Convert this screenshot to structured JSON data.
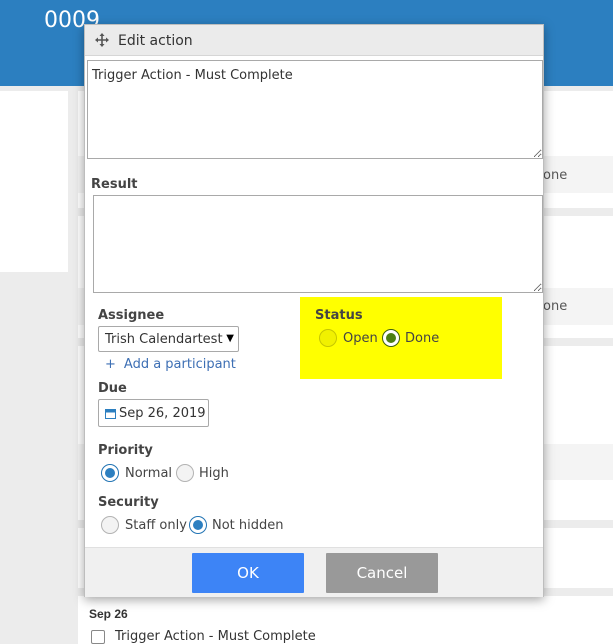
{
  "page": {
    "header_title": "0009",
    "background_done_label_1": "one",
    "background_done_label_2": "one"
  },
  "dialog": {
    "title": "Edit action",
    "action_text": "Trigger Action - Must Complete",
    "result_label": "Result",
    "result_value": "",
    "assignee_label": "Assignee",
    "assignee_value": "Trish Calendartest",
    "add_participant": "Add a participant",
    "due_label": "Due",
    "due_value": "Sep 26, 2019",
    "status_label": "Status",
    "status_options": [
      "Open",
      "Done"
    ],
    "status_selected": "Done",
    "priority_label": "Priority",
    "priority_options": [
      "Normal",
      "High"
    ],
    "priority_selected": "Normal",
    "security_label": "Security",
    "security_options": [
      "Staff only",
      "Not hidden"
    ],
    "security_selected": "Not hidden",
    "ok_label": "OK",
    "cancel_label": "Cancel"
  },
  "list_below": {
    "date_heading": "Sep 26",
    "item_label": "Trigger Action - Must Complete"
  },
  "colors": {
    "header_blue": "#2c7fc0",
    "ok_blue": "#3d84f6",
    "cancel_gray": "#999999",
    "highlight_yellow": "#ffff00",
    "link_blue": "#3d6fb4"
  }
}
